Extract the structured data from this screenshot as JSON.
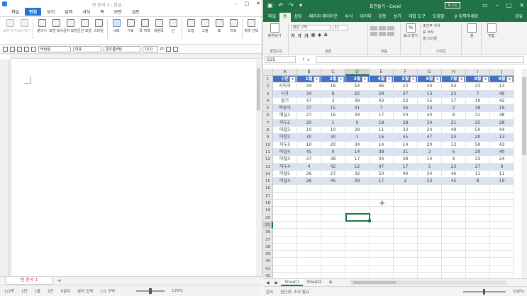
{
  "left": {
    "title": "빈 문서 1 - 한글",
    "menu": [
      {
        "label": "파일",
        "active": false
      },
      {
        "label": "편집",
        "active": true
      },
      {
        "label": "보기",
        "active": false
      },
      {
        "label": "입력",
        "active": false
      },
      {
        "label": "서식",
        "active": false
      },
      {
        "label": "쪽",
        "active": false
      },
      {
        "label": "보안",
        "active": false
      },
      {
        "label": "검토",
        "active": false
      }
    ],
    "ribbon": [
      {
        "label": "오려 두기",
        "dim": true
      },
      {
        "label": "복사하기",
        "dim": true
      },
      {
        "label": "붙이기",
        "dim": false
      },
      {
        "label": "모양 복사",
        "dim": false
      },
      {
        "label": "글자 모양",
        "dim": false
      },
      {
        "label": "문단 모양",
        "dim": false
      },
      {
        "label": "스타일",
        "dim": false
      },
      {
        "label": "세로",
        "dim": false,
        "sel": true
      },
      {
        "label": "가로",
        "dim": false
      },
      {
        "label": "쪽 여백",
        "dim": false
      },
      {
        "label": "바탕쪽",
        "dim": false
      },
      {
        "label": "단",
        "dim": false
      },
      {
        "label": "도형",
        "dim": false
      },
      {
        "label": "그림",
        "dim": false
      },
      {
        "label": "표",
        "dim": false
      },
      {
        "label": "차트",
        "dim": false
      },
      {
        "label": "개체 선택",
        "dim": false
      }
    ],
    "toolbar": {
      "style": "바탕글",
      "lang": "대표",
      "font": "함초롬바탕",
      "size": "10.0",
      "unit": "pt"
    },
    "doc_tab": "빈 문서 1",
    "status": [
      "1/1쪽",
      "1단",
      "1줄",
      "1칸",
      "0글자",
      "문자 입력",
      "1/1 구역"
    ],
    "zoom": "125%"
  },
  "right": {
    "title": "표만들기 - Excel",
    "login": "로그인",
    "tabs": [
      "파일",
      "홈",
      "삽입",
      "페이지 레이아웃",
      "수식",
      "데이터",
      "검토",
      "보기",
      "개발 도구",
      "도움말"
    ],
    "active_tab": "홈",
    "help": "입력하세요",
    "share": "공유",
    "ribbon": {
      "paste": "붙여넣기",
      "clipboard": "클립보드",
      "font_name": "맑은 고딕",
      "font_size": "11",
      "font": "글꼴",
      "align": "맞춤",
      "percent": "표시 형식",
      "cond_format": "조건부 서식",
      "table_format": "표 서식",
      "cell_style": "셀 스타일",
      "style": "스타일",
      "cell": "셀",
      "edit": "편집"
    },
    "namebox": "D35",
    "fx": "fx",
    "columns": [
      "A",
      "B",
      "C",
      "D",
      "E",
      "F",
      "G",
      "H",
      "I",
      "J"
    ],
    "selected_column": "D",
    "table_header": [
      "구분",
      "1월",
      "2월",
      "3월",
      "4월",
      "5월",
      "6월",
      "7월",
      "8월",
      "9월"
    ],
    "rows": [
      [
        "사하자",
        "34",
        "16",
        "54",
        "46",
        "23",
        "34",
        "54",
        "23",
        "13"
      ],
      [
        "사과",
        "34",
        "8",
        "22",
        "29",
        "37",
        "13",
        "23",
        "7",
        "49"
      ],
      [
        "딸기",
        "47",
        "3",
        "39",
        "43",
        "33",
        "15",
        "17",
        "10",
        "42"
      ],
      [
        "복숭아",
        "37",
        "15",
        "41",
        "7",
        "36",
        "33",
        "2",
        "38",
        "19"
      ],
      [
        "메실1",
        "27",
        "16",
        "34",
        "17",
        "50",
        "40",
        "8",
        "31",
        "48"
      ],
      [
        "자두2",
        "20",
        "1",
        "9",
        "18",
        "28",
        "34",
        "21",
        "25",
        "28"
      ],
      [
        "마철3",
        "10",
        "10",
        "39",
        "11",
        "33",
        "24",
        "49",
        "50",
        "44"
      ],
      [
        "마정2",
        "30",
        "30",
        "1",
        "16",
        "45",
        "47",
        "24",
        "20",
        "13"
      ],
      [
        "자두3",
        "10",
        "20",
        "34",
        "14",
        "14",
        "20",
        "13",
        "50",
        "43"
      ],
      [
        "마실4",
        "45",
        "9",
        "14",
        "38",
        "31",
        "3",
        "6",
        "29",
        "40"
      ],
      [
        "마철3",
        "37",
        "38",
        "17",
        "34",
        "38",
        "14",
        "9",
        "33",
        "24"
      ],
      [
        "자두4",
        "4",
        "42",
        "12",
        "47",
        "17",
        "5",
        "23",
        "27",
        "9"
      ],
      [
        "마철5",
        "26",
        "27",
        "32",
        "50",
        "40",
        "34",
        "46",
        "11",
        "11"
      ],
      [
        "마실4",
        "26",
        "46",
        "39",
        "17",
        "2",
        "23",
        "45",
        "8",
        "19"
      ]
    ],
    "row_numbers": [
      "1",
      "2",
      "3",
      "4",
      "5",
      "6",
      "7",
      "8",
      "9",
      "10",
      "11",
      "12",
      "13",
      "14",
      "15",
      "16",
      "17",
      "18",
      "19",
      "20",
      "35",
      "36",
      "37",
      "38",
      "39",
      "40",
      "41",
      "42"
    ],
    "selected_row": "35",
    "sheets": [
      "Sheet1",
      "Sheet2"
    ],
    "active_sheet": "Sheet1",
    "status": [
      "준비",
      "접근성: 조사 필요"
    ],
    "zoom": "100%",
    "colors": {
      "brand": "#217346",
      "header": "#4472c4",
      "band": "#d9e1f2"
    }
  }
}
